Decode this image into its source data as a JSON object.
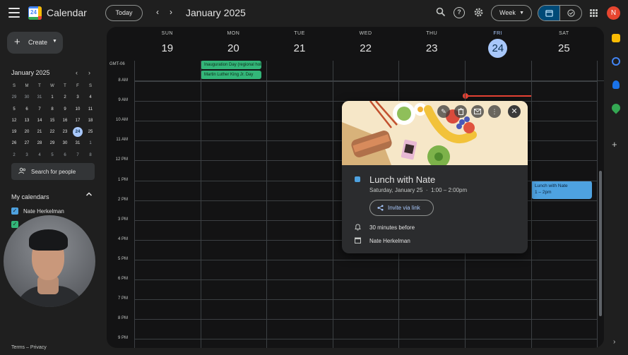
{
  "header": {
    "app_title": "Calendar",
    "logo_number": "24",
    "today_label": "Today",
    "prev_arrow": "‹",
    "next_arrow": "›",
    "month_title": "January 2025",
    "view_label": "Week",
    "avatar_letter": "N"
  },
  "sidebar": {
    "create_label": "Create",
    "mini_month_title": "January 2025",
    "weekday_initials": [
      "S",
      "M",
      "T",
      "W",
      "T",
      "F",
      "S"
    ],
    "mini_weeks": [
      [
        "29",
        "30",
        "31",
        "1",
        "2",
        "3",
        "4"
      ],
      [
        "5",
        "6",
        "7",
        "8",
        "9",
        "10",
        "11"
      ],
      [
        "12",
        "13",
        "14",
        "15",
        "16",
        "17",
        "18"
      ],
      [
        "19",
        "20",
        "21",
        "22",
        "23",
        "24",
        "25"
      ],
      [
        "26",
        "27",
        "28",
        "29",
        "30",
        "31",
        "1"
      ],
      [
        "2",
        "3",
        "4",
        "5",
        "6",
        "7",
        "8"
      ]
    ],
    "search_people_placeholder": "Search for people",
    "my_calendars_label": "My calendars",
    "calendars": [
      {
        "name": "Nate Herkelman",
        "color": "#4ea2e0"
      },
      {
        "name": "",
        "color": "#33b679"
      }
    ],
    "footer_links": "Terms – Privacy"
  },
  "week": {
    "timezone": "GMT-06",
    "days": [
      {
        "dow": "SUN",
        "num": "19"
      },
      {
        "dow": "MON",
        "num": "20"
      },
      {
        "dow": "TUE",
        "num": "21"
      },
      {
        "dow": "WED",
        "num": "22"
      },
      {
        "dow": "THU",
        "num": "23"
      },
      {
        "dow": "FRI",
        "num": "24"
      },
      {
        "dow": "SAT",
        "num": "25"
      }
    ],
    "hours": [
      "8 AM",
      "9 AM",
      "10 AM",
      "11 AM",
      "12 PM",
      "1 PM",
      "2 PM",
      "3 PM",
      "4 PM",
      "5 PM",
      "6 PM",
      "7 PM",
      "8 PM",
      "9 PM"
    ],
    "allday_events": [
      {
        "title": "Inauguration Day (regional holiday)",
        "color": "#33b679"
      },
      {
        "title": "Martin Luther King Jr. Day",
        "color": "#33b679"
      }
    ],
    "timed_event": {
      "title": "Lunch with Nate",
      "time": "1 – 2pm",
      "color": "#4ea2e0"
    }
  },
  "popup": {
    "title": "Lunch with Nate",
    "when": "Saturday, January 25  ·  1:00 – 2:00pm",
    "invite_label": "Invite via link",
    "reminder": "30 minutes before",
    "calendar_owner": "Nate Herkelman"
  },
  "colors": {
    "accent": "#a8c7fa",
    "event_blue": "#4ea2e0",
    "holiday_green": "#33b679",
    "now_line": "#ea4335"
  }
}
